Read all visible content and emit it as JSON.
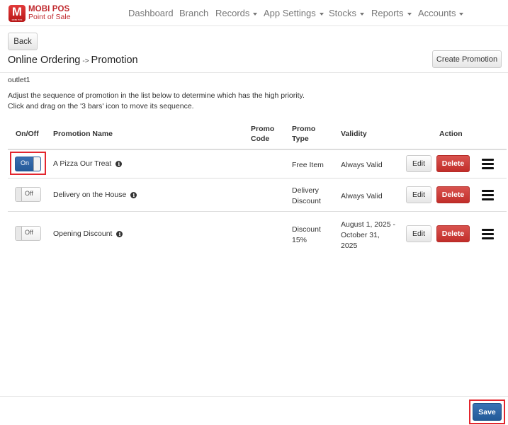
{
  "brand": {
    "name": "MOBI POS",
    "tagline": "Point of Sale",
    "logo_letter": "M",
    "logo_small": "MOBI POS"
  },
  "nav": [
    {
      "label": "Dashboard",
      "dropdown": false
    },
    {
      "label": "Branch",
      "dropdown": false
    },
    {
      "label": "Records",
      "dropdown": true
    },
    {
      "label": "App Settings",
      "dropdown": true
    },
    {
      "label": "Stocks",
      "dropdown": true
    },
    {
      "label": "Reports",
      "dropdown": true
    },
    {
      "label": "Accounts",
      "dropdown": true
    }
  ],
  "back_label": "Back",
  "breadcrumb": {
    "parent": "Online Ordering",
    "separator": "->",
    "current": "Promotion"
  },
  "create_label": "Create Promotion",
  "outlet": "outlet1",
  "instructions": [
    "Adjust the sequence of promotion in the list below to determine which has the high priority.",
    "Click and drag on the '3 bars' icon to move its sequence."
  ],
  "table": {
    "headers": {
      "onoff": "On/Off",
      "name": "Promotion Name",
      "code": [
        "Promo",
        "Code"
      ],
      "type": [
        "Promo",
        "Type"
      ],
      "validity": "Validity",
      "action": "Action"
    },
    "rows": [
      {
        "toggle": "On",
        "name": "A Pizza Our Treat",
        "code": "",
        "type": [
          "Free Item"
        ],
        "validity": [
          "Always Valid"
        ]
      },
      {
        "toggle": "Off",
        "name": "Delivery on the House",
        "code": "",
        "type": [
          "Delivery",
          "Discount"
        ],
        "validity": [
          "Always Valid"
        ]
      },
      {
        "toggle": "Off",
        "name": "Opening Discount",
        "code": "",
        "type": [
          "Discount",
          "15%"
        ],
        "validity": [
          "August 1, 2025 -",
          "October 31,",
          "2025"
        ]
      }
    ],
    "edit_label": "Edit",
    "delete_label": "Delete"
  },
  "save_label": "Save",
  "colors": {
    "brand": "#c0282d",
    "primary": "#245a9a",
    "danger": "#c9302c",
    "highlight": "#e3262e"
  },
  "icons": {
    "info": "info-icon",
    "drag": "bars-icon"
  }
}
